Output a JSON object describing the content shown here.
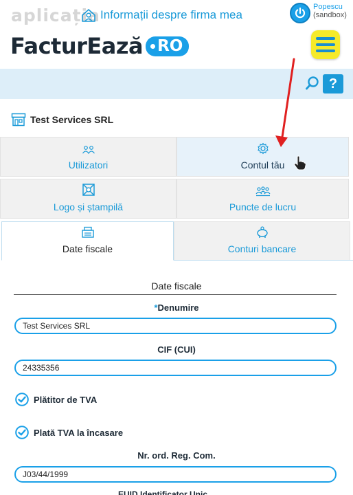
{
  "header": {
    "app_tag": "aplicația",
    "logo_main": "FacturEază",
    "logo_badge": "RO",
    "user_name": "Popescu",
    "user_env": "(sandbox)"
  },
  "title_bar": {
    "title": "Informații despre firma mea",
    "help_label": "?"
  },
  "company": {
    "name": "Test Services SRL"
  },
  "tabs": {
    "users": "Utilizatori",
    "account": "Contul tău",
    "logo": "Logo și ștampilă",
    "workpoints": "Puncte de lucru",
    "fiscal": "Date fiscale",
    "banks": "Conturi bancare"
  },
  "form": {
    "section_title": "Date fiscale",
    "name_required_mark": "*",
    "name_label": "Denumire",
    "name_value": "Test Services SRL",
    "cif_label": "CIF (CUI)",
    "cif_value": "24335356",
    "vat_payer_label": "Plătitor de TVA",
    "vat_cash_label": "Plată TVA la încasare",
    "reg_label": "Nr. ord. Reg. Com.",
    "reg_value": "J03/44/1999",
    "cut_off_text": "EUID Identificator Unic"
  },
  "colors": {
    "accent": "#1aa0e8",
    "menu_yellow": "#f6ea2a",
    "annotation_red": "#e02020"
  }
}
